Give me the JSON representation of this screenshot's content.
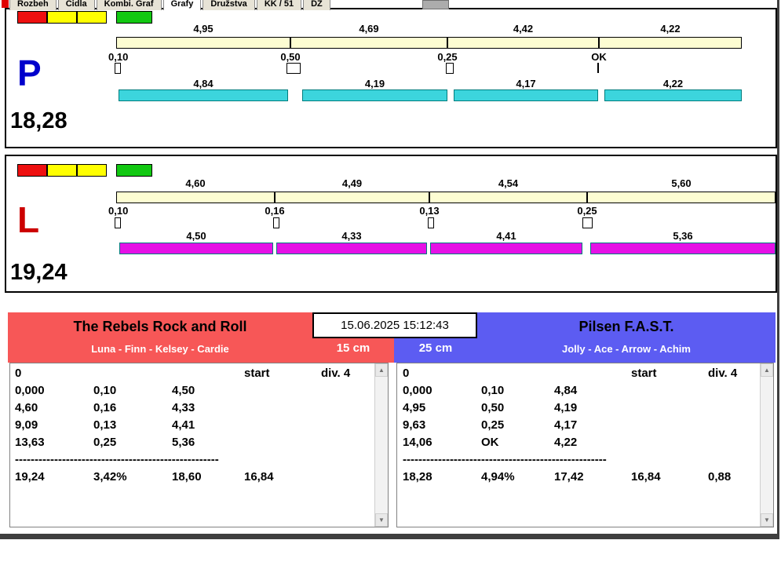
{
  "window": {
    "tabs": [
      "Rozbeh",
      "Cidla",
      "Kombi. Graf",
      "Grafy",
      "Družstva",
      "KK / 51",
      "DZ"
    ],
    "active_tab": "Grafy"
  },
  "status_lights": [
    "#ee1010",
    "#ffff00",
    "#ffff00",
    "#12c812"
  ],
  "icons": {
    "scroll_up": "▲",
    "scroll_down": "▼"
  },
  "timestamp": "15.06.2025 15:12:43",
  "lanes": {
    "p": {
      "letter": "P",
      "letter_color": "#0000cc",
      "total": "18,28",
      "bar_color": "#3cd5dd",
      "top_values": [
        "4,95",
        "4,69",
        "4,42",
        "4,22"
      ],
      "change_values": [
        "0,10",
        "0,50",
        "0,25",
        "OK"
      ],
      "bottom_values": [
        "4,84",
        "4,19",
        "4,17",
        "4,22"
      ]
    },
    "l": {
      "letter": "L",
      "letter_color": "#cc0000",
      "total": "19,24",
      "bar_color": "#e511e5",
      "top_values": [
        "4,60",
        "4,49",
        "4,54",
        "5,60"
      ],
      "change_values": [
        "0,10",
        "0,16",
        "0,13",
        "0,25"
      ],
      "bottom_values": [
        "4,50",
        "4,33",
        "4,41",
        "5,36"
      ]
    }
  },
  "teams": {
    "left": {
      "name": "The Rebels Rock and Roll",
      "members": "Luna - Finn - Kelsey - Cardie",
      "category": "15 cm",
      "accent": "#f75757",
      "rows": [
        [
          "0",
          "",
          "",
          "start",
          "div. 4"
        ],
        [
          "0,000",
          "0,10",
          "4,50",
          "",
          ""
        ],
        [
          "4,60",
          "0,16",
          "4,33",
          "",
          ""
        ],
        [
          "9,09",
          "0,13",
          "4,41",
          "",
          ""
        ],
        [
          "13,63",
          "0,25",
          "5,36",
          "",
          ""
        ],
        [
          "----------------------------------------------------",
          "",
          "",
          "",
          ""
        ],
        [
          "19,24",
          "3,42%",
          "18,60",
          "16,84",
          ""
        ]
      ]
    },
    "right": {
      "name": "Pilsen F.A.S.T.",
      "members": "Jolly - Ace - Arrow - Achim",
      "category": "25 cm",
      "accent": "#5c5cf2",
      "rows": [
        [
          "0",
          "",
          "",
          "start",
          "div. 4"
        ],
        [
          "0,000",
          "0,10",
          "4,84",
          "",
          ""
        ],
        [
          "4,95",
          "0,50",
          "4,19",
          "",
          ""
        ],
        [
          "9,63",
          "0,25",
          "4,17",
          "",
          ""
        ],
        [
          "14,06",
          "OK",
          "4,22",
          "",
          ""
        ],
        [
          "----------------------------------------------------",
          "",
          "",
          "",
          ""
        ],
        [
          "18,28",
          "4,94%",
          "17,42",
          "16,84",
          "0,88"
        ]
      ]
    }
  }
}
